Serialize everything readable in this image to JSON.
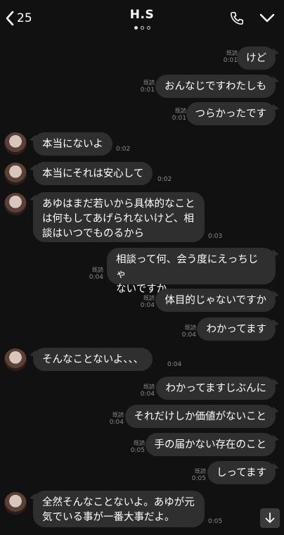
{
  "header": {
    "back_count": "25",
    "title": "H.S"
  },
  "read_label": "既読",
  "top_partial_time": "0:01",
  "messages": [
    {
      "text": "けど",
      "time": "0:01"
    },
    {
      "text": "おんなじですわたしも",
      "time": "0:01"
    },
    {
      "text": "つらかったです",
      "time": "0:01"
    },
    {
      "text": "本当にないよ",
      "time": "0:02"
    },
    {
      "text": "本当にそれは安心して",
      "time": "0:02"
    },
    {
      "line1": "あゆはまだ若いから具体的なこと",
      "line2": "は何もしてあげられないけど、相",
      "line3": "談はいつでものるから",
      "time": "0:03"
    },
    {
      "line1": "相談って何、会う度にえっちじゃ",
      "line2": "ないですか",
      "time": "0:04"
    },
    {
      "text": "体目的じゃないですか",
      "time": "0:04"
    },
    {
      "text": "わかってます",
      "time": "0:04"
    },
    {
      "text": "そんなことないよ、、、",
      "time": "0:04"
    },
    {
      "text": "わかってますじぶんに",
      "time": "0:04"
    },
    {
      "text": "それだけしか価値がないこと",
      "time": "0:04"
    },
    {
      "text": "手の届かない存在のこと",
      "time": "0:05"
    },
    {
      "text": "しってます",
      "time": "0:05"
    },
    {
      "line1": "全然そんなことないよ。あゆが元",
      "line2": "気でいる事が一番大事だよ。",
      "time": "0:05"
    }
  ]
}
